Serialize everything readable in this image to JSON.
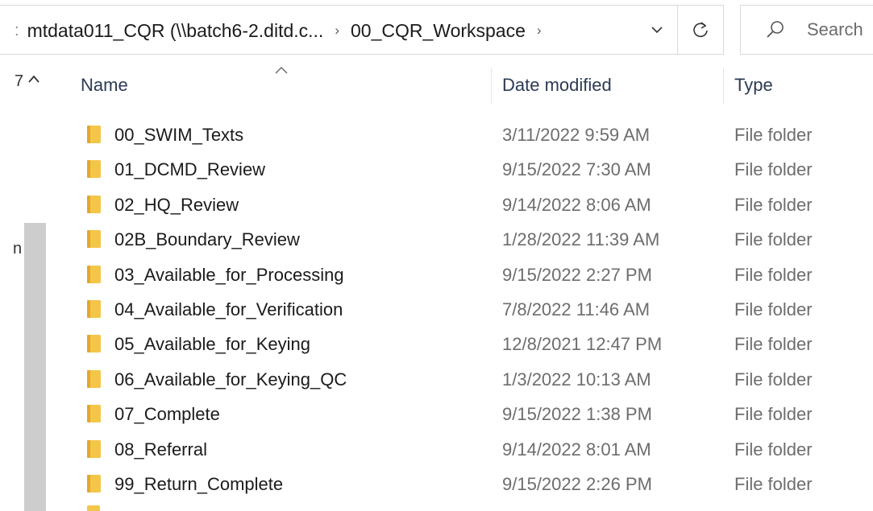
{
  "address_bar": {
    "leading_text": ":",
    "crumbs": [
      "mtdata011_CQR (\\\\batch6-2.ditd.c...",
      "00_CQR_Workspace"
    ],
    "separator": "›"
  },
  "search": {
    "placeholder": "Search"
  },
  "nav_pane": {
    "truncated_labels": [
      "7",
      "n"
    ]
  },
  "columns": {
    "name": "Name",
    "date_modified": "Date modified",
    "type": "Type"
  },
  "files": [
    {
      "name": "00_SWIM_Texts",
      "date": "3/11/2022 9:59 AM",
      "type": "File folder"
    },
    {
      "name": "01_DCMD_Review",
      "date": "9/15/2022 7:30 AM",
      "type": "File folder"
    },
    {
      "name": "02_HQ_Review",
      "date": "9/14/2022 8:06 AM",
      "type": "File folder"
    },
    {
      "name": "02B_Boundary_Review",
      "date": "1/28/2022 11:39 AM",
      "type": "File folder"
    },
    {
      "name": "03_Available_for_Processing",
      "date": "9/15/2022 2:27 PM",
      "type": "File folder"
    },
    {
      "name": "04_Available_for_Verification",
      "date": "7/8/2022 11:46 AM",
      "type": "File folder"
    },
    {
      "name": "05_Available_for_Keying",
      "date": "12/8/2021 12:47 PM",
      "type": "File folder"
    },
    {
      "name": "06_Available_for_Keying_QC",
      "date": "1/3/2022 10:13 AM",
      "type": "File folder"
    },
    {
      "name": "07_Complete",
      "date": "9/15/2022 1:38 PM",
      "type": "File folder"
    },
    {
      "name": "08_Referral",
      "date": "9/14/2022 8:01 AM",
      "type": "File folder"
    },
    {
      "name": "99_Return_Complete",
      "date": "9/15/2022 2:26 PM",
      "type": "File folder"
    }
  ],
  "colors": {
    "folder": "#f3c64a",
    "folder_dark": "#e2a829",
    "border": "#d9d9d9",
    "scroll_thumb": "#cdcdcd",
    "header_text": "#2b3a55"
  },
  "icons": {
    "dropdown": "chevron-down-icon",
    "refresh": "refresh-icon",
    "search": "search-icon",
    "folder": "folder-icon",
    "sort": "sort-ascending-icon",
    "scroll_up": "scroll-up-icon"
  }
}
